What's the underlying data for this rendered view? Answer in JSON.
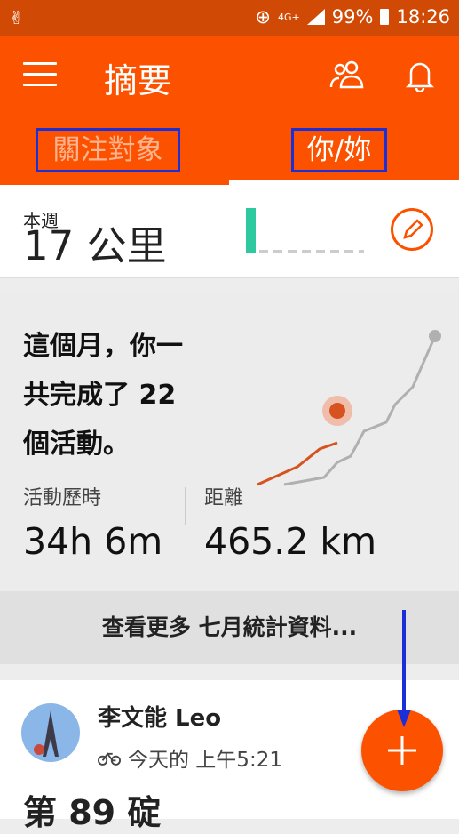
{
  "status_bar": {
    "network": "4G+",
    "battery": "99%",
    "time": "18:26"
  },
  "app_bar": {
    "title": "摘要"
  },
  "tabs": [
    {
      "label": "關注對象"
    },
    {
      "label": "你/妳"
    }
  ],
  "week": {
    "label": "本週",
    "distance": "17 公里"
  },
  "month": {
    "headline_lines": [
      "這個月，你一",
      "共完成了 22",
      "個活動。"
    ],
    "duration_label": "活動歷時",
    "duration_value": "34h 6m",
    "distance_label": "距離",
    "distance_value": "465.2 km",
    "more_label": "查看更多 七月統計資料..."
  },
  "feed": {
    "athlete": "李文能 Leo",
    "when": "今天的 上午5:21",
    "activity_title": "第 89 碇"
  },
  "colors": {
    "brand": "#fc5200",
    "accent": "#2fc9a0",
    "annotation": "#1b2fd8"
  }
}
